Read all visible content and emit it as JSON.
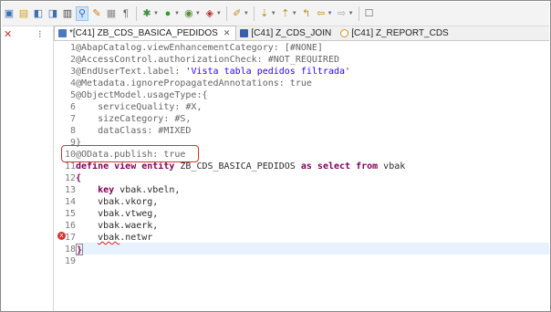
{
  "toolbar": {
    "icons": [
      "new-icon",
      "open-icon",
      "save-icon",
      "save-all-icon",
      "print-icon",
      "run-icon",
      "debug-icon",
      "format-icon",
      "toggle-comment-icon",
      "prev-annotation-icon",
      "next-annotation-icon",
      "back-icon",
      "forward-icon",
      "pin-icon"
    ]
  },
  "tabs": [
    {
      "label": "*[C41] ZB_CDS_BASICA_PEDIDOS",
      "active": true,
      "close": "✕"
    },
    {
      "label": "[C41] Z_CDS_JOIN",
      "active": false
    },
    {
      "label": "[C41] Z_REPORT_CDS",
      "active": false
    }
  ],
  "editor": {
    "lines": [
      {
        "n": "1",
        "text": "@AbapCatalog.viewEnhancementCategory: [#NONE]"
      },
      {
        "n": "2",
        "text": "@AccessControl.authorizationCheck: #NOT_REQUIRED"
      },
      {
        "n": "3",
        "pre": "@EndUserText.label: ",
        "str": "'Vista tabla pedidos filtrada'"
      },
      {
        "n": "4",
        "text": "@Metadata.ignorePropagatedAnnotations: true"
      },
      {
        "n": "5",
        "text": "@ObjectModel.usageType:{"
      },
      {
        "n": "6",
        "text": "    serviceQuality: #X,"
      },
      {
        "n": "7",
        "text": "    sizeCategory: #S,"
      },
      {
        "n": "8",
        "text": "    dataClass: #MIXED"
      },
      {
        "n": "9",
        "text": "}"
      },
      {
        "n": "10",
        "text": "@OData.publish: true"
      },
      {
        "n": "11",
        "kw1": "define view entity",
        "mid": " ZB_CDS_BASICA_PEDIDOS ",
        "kw2": "as select from",
        "post": " vbak"
      },
      {
        "n": "12",
        "text": "{"
      },
      {
        "n": "13",
        "kw1": "    key",
        "post": " vbak.vbeln,"
      },
      {
        "n": "14",
        "text": "    vbak.vkorg,"
      },
      {
        "n": "15",
        "text": "    vbak.vtweg,"
      },
      {
        "n": "16",
        "text": "    vbak.waerk,"
      },
      {
        "n": "17",
        "pre": "    ",
        "err": "vbak",
        "post": ".netwr"
      },
      {
        "n": "18",
        "text": "}"
      },
      {
        "n": "19",
        "text": ""
      }
    ],
    "error_marker": "x"
  }
}
